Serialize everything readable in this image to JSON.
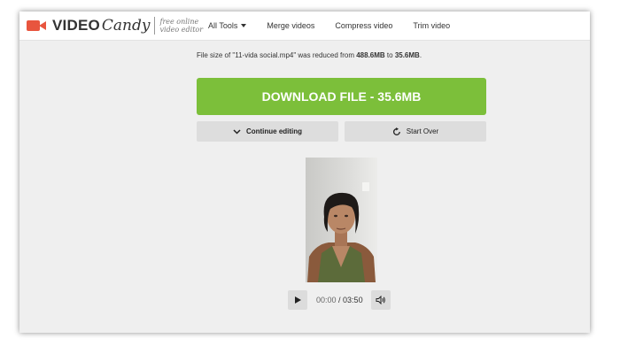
{
  "header": {
    "logo_video": "VIDEO",
    "logo_candy": "Candy",
    "tagline_line1": "free online",
    "tagline_line2": "video editor",
    "nav": [
      {
        "label": "All Tools"
      },
      {
        "label": "Merge videos"
      },
      {
        "label": "Compress video"
      },
      {
        "label": "Trim video"
      }
    ]
  },
  "result": {
    "prefix": "File size of \"11-vida social.mp4\" was reduced from ",
    "original_size": "488.6MB",
    "middle": " to ",
    "new_size": "35.6MB",
    "suffix": "."
  },
  "actions": {
    "download_label": "DOWNLOAD FILE - 35.6MB",
    "continue_label": "Continue editing",
    "start_over_label": "Start Over"
  },
  "player": {
    "current_time": "00:00",
    "separator": " / ",
    "duration": "03:50"
  },
  "colors": {
    "accent_green": "#7cbf3a",
    "logo_red": "#e8553e"
  },
  "icons": {
    "logo": "video-camera-icon",
    "continue": "chevron-down-icon",
    "start_over": "refresh-icon",
    "play": "play-icon",
    "volume": "volume-icon"
  }
}
